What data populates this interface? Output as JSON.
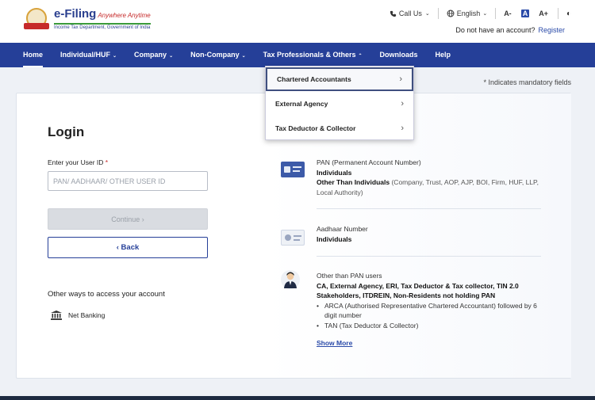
{
  "header": {
    "brand_name": "e-Filing",
    "brand_tag": "Anywhere Anytime",
    "brand_sub": "Income Tax Department, Government of India",
    "call_us": "Call Us",
    "language": "English",
    "font_decrease": "A-",
    "font_normal": "A",
    "font_increase": "A+",
    "no_account_text": "Do not have an account?",
    "register_link": "Register"
  },
  "nav": {
    "items": [
      {
        "label": "Home",
        "caret": ""
      },
      {
        "label": "Individual/HUF",
        "caret": "⌄"
      },
      {
        "label": "Company",
        "caret": "⌄"
      },
      {
        "label": "Non-Company",
        "caret": "⌄"
      },
      {
        "label": "Tax Professionals & Others",
        "caret": "⌃"
      },
      {
        "label": "Downloads",
        "caret": ""
      },
      {
        "label": "Help",
        "caret": ""
      }
    ]
  },
  "dropdown": {
    "items": [
      {
        "label": "Chartered Accountants"
      },
      {
        "label": "External Agency"
      },
      {
        "label": "Tax Deductor & Collector"
      }
    ]
  },
  "mandatory_note": "* Indicates mandatory fields",
  "login": {
    "title": "Login",
    "userid_label": "Enter your User ID",
    "required_mark": "*",
    "userid_placeholder": "PAN/ AADHAAR/ OTHER USER ID",
    "userid_value": "",
    "continue_label": "Continue",
    "back_label": "Back",
    "other_ways": "Other ways to access your account",
    "net_banking": "Net Banking"
  },
  "info": {
    "pan": {
      "title": "PAN (Permanent Account Number)",
      "individuals": "Individuals",
      "other_label": "Other Than Individuals",
      "other_detail": "(Company, Trust, AOP, AJP, BOI, Firm, HUF, LLP, Local Authority)"
    },
    "aadhaar": {
      "title": "Aadhaar Number",
      "individuals": "Individuals"
    },
    "other_pan": {
      "title": "Other than PAN users",
      "who": "CA, External Agency, ERI, Tax Deductor & Tax collector, TIN 2.0 Stakeholders, ITDREIN, Non-Residents not holding PAN",
      "bullets": [
        "ARCA (Authorised Representative Chartered Accountant) followed by 6 digit number",
        "TAN (Tax Deductor & Collector)"
      ],
      "show_more": "Show More"
    }
  },
  "colors": {
    "nav_bg": "#253f98",
    "link": "#2a4aa8",
    "accent_red": "#c62a2a"
  }
}
